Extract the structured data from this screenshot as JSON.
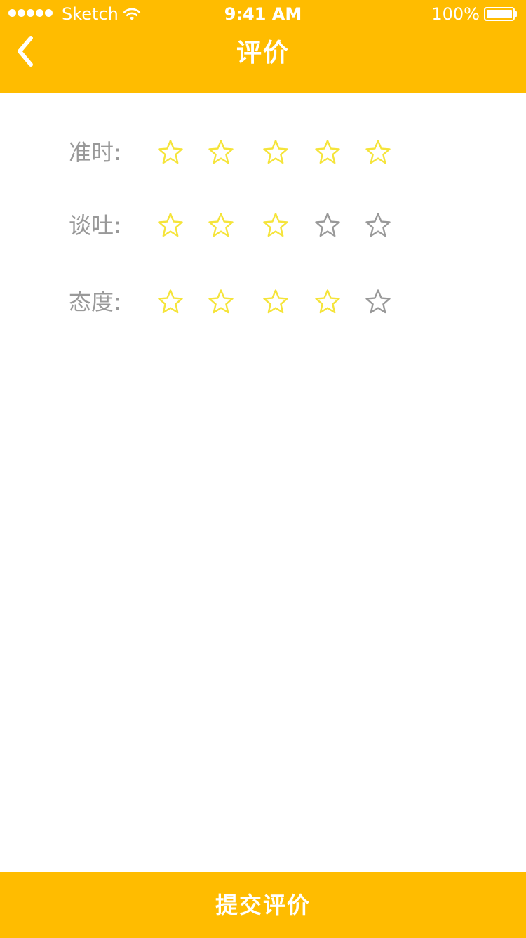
{
  "status_bar": {
    "carrier": "Sketch",
    "time": "9:41 AM",
    "battery": "100%"
  },
  "header": {
    "title": "评价"
  },
  "ratings": [
    {
      "label": "准时:",
      "value": 5,
      "max": 5
    },
    {
      "label": "谈吐:",
      "value": 3,
      "max": 5
    },
    {
      "label": "态度:",
      "value": 4,
      "max": 5
    }
  ],
  "submit": {
    "label": "提交评价"
  },
  "colors": {
    "accent": "#FFBC00",
    "star_filled": "#F5E43A",
    "star_empty": "#999999",
    "label": "#999999",
    "text_on_accent": "#FFFFFF"
  },
  "icons": {
    "back": "chevron-left-icon",
    "star": "star-outline-icon",
    "wifi": "wifi-icon",
    "battery": "battery-icon",
    "signal": "signal-dots-icon"
  }
}
